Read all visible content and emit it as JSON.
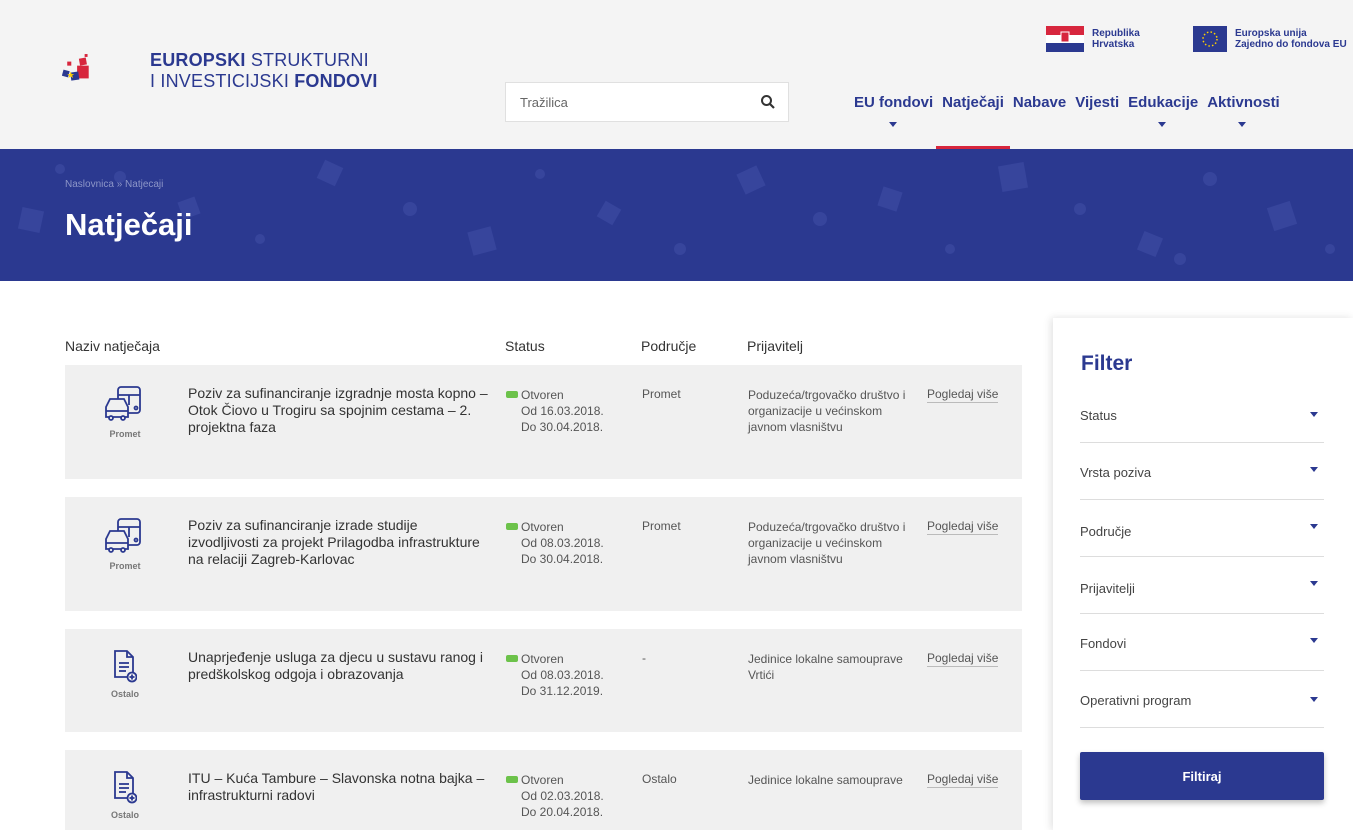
{
  "header": {
    "logo": {
      "line1_bold": "EUROPSKI",
      "line1_rest": " STRUKTURNI",
      "line2_rest": "I INVESTICIJSKI ",
      "line2_bold": "FONDOVI"
    },
    "search": {
      "placeholder": "Tražilica",
      "icon": "search-icon"
    },
    "flags": [
      {
        "line1": "Republika",
        "line2": "Hrvatska"
      },
      {
        "line1": "Europska unija",
        "line2": "Zajedno do fondova EU"
      }
    ],
    "nav": [
      {
        "label": "EU fondovi",
        "has_dropdown": true,
        "active": false
      },
      {
        "label": "Natječaji",
        "has_dropdown": false,
        "active": true
      },
      {
        "label": "Nabave",
        "has_dropdown": false,
        "active": false
      },
      {
        "label": "Vijesti",
        "has_dropdown": false,
        "active": false
      },
      {
        "label": "Edukacije",
        "has_dropdown": true,
        "active": false
      },
      {
        "label": "Aktivnosti",
        "has_dropdown": true,
        "active": false
      }
    ],
    "accent_color": "#2b3990",
    "active_color": "#d7263d"
  },
  "banner": {
    "breadcrumb": "Naslovnica » Natjecaji",
    "title": "Natječaji"
  },
  "table": {
    "columns": {
      "name": "Naziv natječaja",
      "status": "Status",
      "area": "Područje",
      "applicant": "Prijavitelj"
    },
    "rows": [
      {
        "category": "Promet",
        "icon": "bus-car-icon",
        "title": "Poziv za sufinanciranje izgradnje mosta kopno – Otok Čiovo u Trogiru sa spojnim cestama – 2. projektna faza",
        "status": "Otvoren",
        "from": "Od 16.03.2018.",
        "to": "Do 30.04.2018.",
        "area": "Promet",
        "applicant": "Poduzeća/trgovačko društvo i organizacije u većinskom javnom vlasništvu",
        "more": "Pogledaj više"
      },
      {
        "category": "Promet",
        "icon": "bus-car-icon",
        "title": "Poziv za sufinanciranje izrade studije izvodljivosti za projekt Prilagodba infrastrukture na relaciji Zagreb-Karlovac",
        "status": "Otvoren",
        "from": "Od 08.03.2018.",
        "to": "Do 30.04.2018.",
        "area": "Promet",
        "applicant": "Poduzeća/trgovačko društvo i organizacije u većinskom javnom vlasništvu",
        "more": "Pogledaj više"
      },
      {
        "category": "Ostalo",
        "icon": "document-add-icon",
        "title": "Unaprjeđenje usluga za djecu u sustavu ranog i predškolskog odgoja i obrazovanja",
        "status": "Otvoren",
        "from": "Od 08.03.2018.",
        "to": "Do 31.12.2019.",
        "area": "-",
        "applicant": "Jedinice lokalne samouprave\nVrtići",
        "more": "Pogledaj više"
      },
      {
        "category": "Ostalo",
        "icon": "document-add-icon",
        "title": "ITU – Kuća Tambure – Slavonska notna bajka – infrastrukturni radovi",
        "status": "Otvoren",
        "from": "Od 02.03.2018.",
        "to": "Do 20.04.2018.",
        "area": "Ostalo",
        "applicant": "Jedinice lokalne samouprave",
        "more": "Pogledaj više"
      }
    ],
    "status_color": "#6cc24a"
  },
  "filter": {
    "title": "Filter",
    "items": [
      "Status",
      "Vrsta poziva",
      "Područje",
      "Prijavitelji",
      "Fondovi",
      "Operativni program"
    ],
    "button": "Filtiraj"
  }
}
